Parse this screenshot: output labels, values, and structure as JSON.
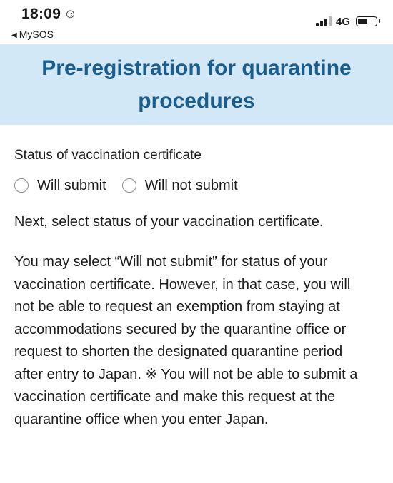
{
  "status_bar": {
    "time": "18:09",
    "time_icon": "☺",
    "back_arrow": "◀",
    "back_label": "MySOS",
    "network": "4G"
  },
  "header": {
    "title": "Pre-registration for quarantine procedures",
    "background": "#d3e8f6",
    "title_color": "#1b5e8e"
  },
  "form": {
    "label": "Status of vaccination certificate",
    "options": [
      {
        "label": "Will submit",
        "selected": false
      },
      {
        "label": "Will not submit",
        "selected": false
      }
    ],
    "instruction": "Next, select status of your vaccination certificate.",
    "notice": "You may select “Will not submit” for status of your vaccination certificate. However, in that case, you will not be able to request an exemption from staying at accommodations secured by the quarantine office or request to shorten the designated quarantine period after entry to Japan. ※ You will not be able to submit a vaccination certificate and make this request at the quarantine office when you enter Japan."
  }
}
